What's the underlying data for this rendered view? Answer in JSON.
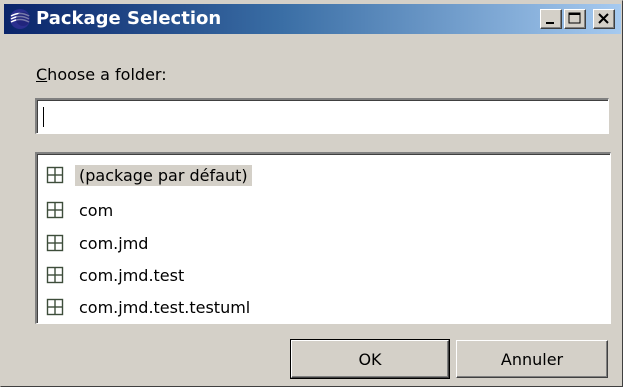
{
  "window": {
    "title": "Package Selection",
    "controls": {
      "minimize_icon": "minimize-icon",
      "maximize_icon": "maximize-icon",
      "close_icon": "close-icon"
    },
    "title_gradient": [
      "#0a246a",
      "#a6caf0"
    ]
  },
  "form": {
    "label_accel": "C",
    "label_rest": "hoose a folder:",
    "input_value": ""
  },
  "packages": [
    {
      "label": "(package par défaut)",
      "selected": true,
      "icon": "package-icon"
    },
    {
      "label": "com",
      "selected": false,
      "icon": "package-icon"
    },
    {
      "label": "com.jmd",
      "selected": false,
      "icon": "package-icon"
    },
    {
      "label": "com.jmd.test",
      "selected": false,
      "icon": "package-icon"
    },
    {
      "label": "com.jmd.test.testuml",
      "selected": false,
      "icon": "package-icon"
    }
  ],
  "buttons": {
    "ok_label": "OK",
    "cancel_label": "Annuler"
  }
}
